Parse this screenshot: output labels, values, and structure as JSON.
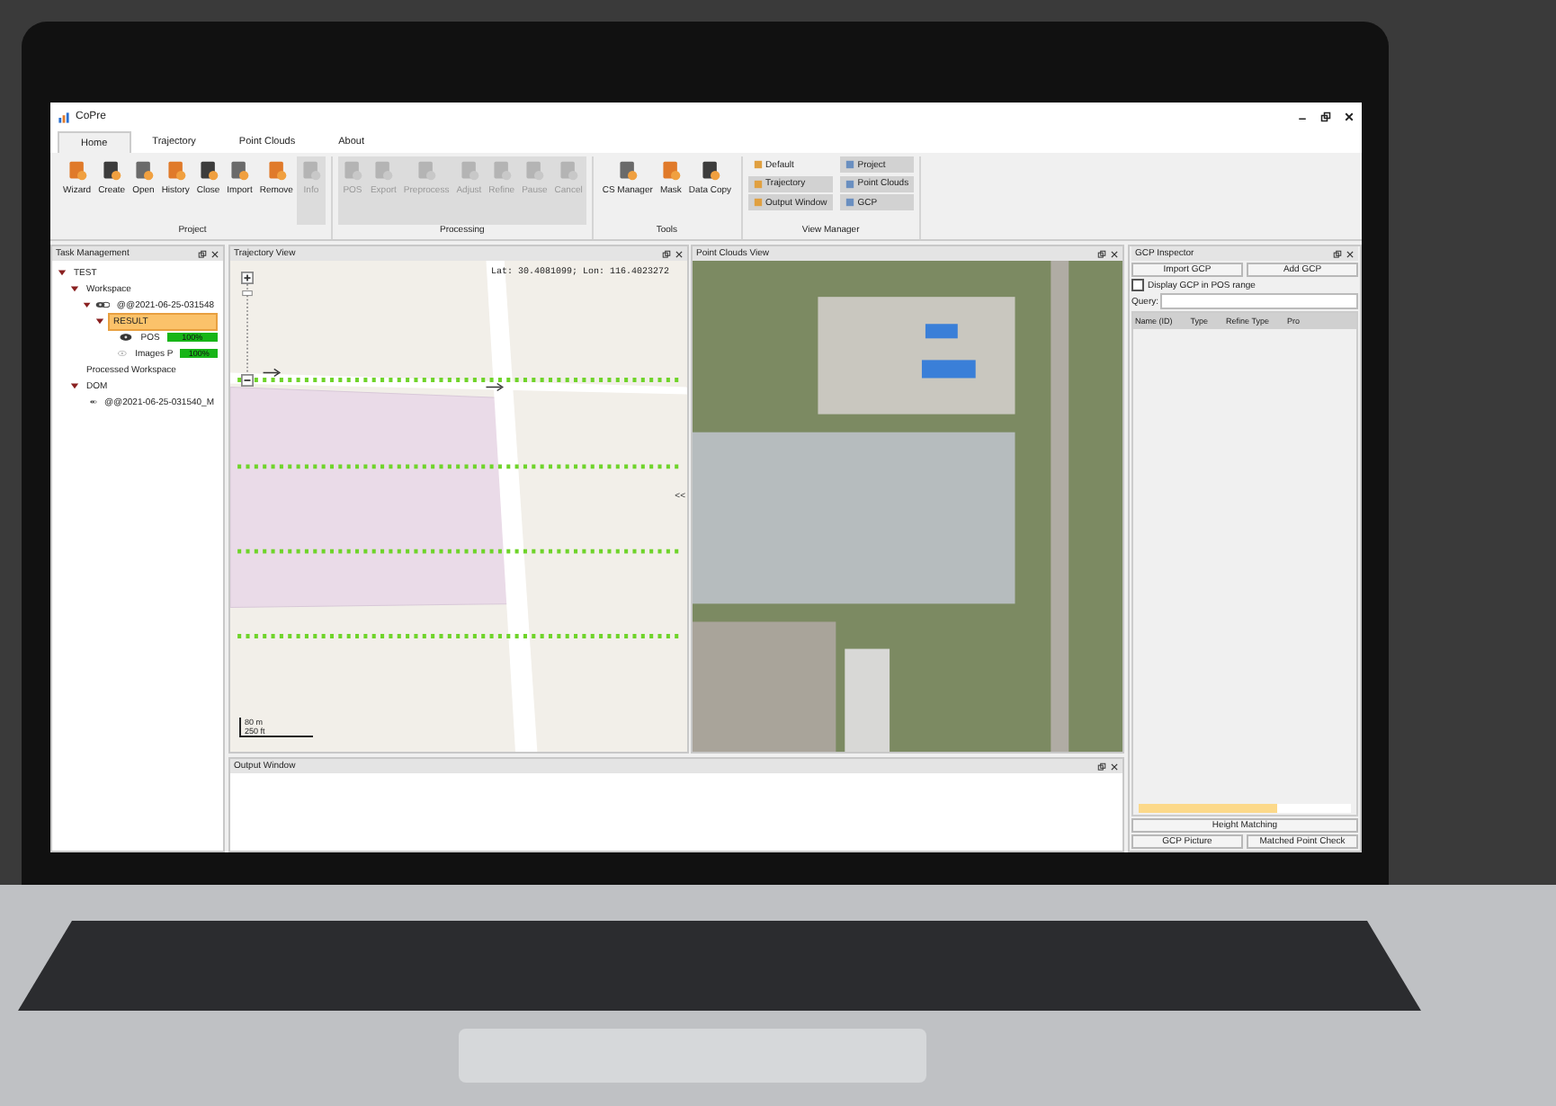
{
  "window": {
    "title": "CoPre"
  },
  "tabs": [
    {
      "label": "Home",
      "selected": true
    },
    {
      "label": "Trajectory",
      "selected": false
    },
    {
      "label": "Point Clouds",
      "selected": false
    },
    {
      "label": "About",
      "selected": false
    }
  ],
  "ribbon": [
    {
      "label": "Project",
      "kind": "buttons",
      "buttons": [
        {
          "label": "Wizard",
          "disabled": false
        },
        {
          "label": "Create",
          "disabled": false
        },
        {
          "label": "Open",
          "disabled": false
        },
        {
          "label": "History",
          "disabled": false
        },
        {
          "label": "Close",
          "disabled": false
        },
        {
          "label": "Import",
          "disabled": false
        },
        {
          "label": "Remove",
          "disabled": false
        },
        {
          "label": "Info",
          "disabled": true
        }
      ]
    },
    {
      "label": "Processing",
      "kind": "buttons",
      "buttons": [
        {
          "label": "POS",
          "disabled": true
        },
        {
          "label": "Export",
          "disabled": true
        },
        {
          "label": "Preprocess",
          "disabled": true
        },
        {
          "label": "Adjust",
          "disabled": true
        },
        {
          "label": "Refine",
          "disabled": true
        },
        {
          "label": "Pause",
          "disabled": true
        },
        {
          "label": "Cancel",
          "disabled": true
        }
      ]
    },
    {
      "label": "Tools",
      "kind": "buttons",
      "buttons": [
        {
          "label": "CS Manager",
          "disabled": false
        },
        {
          "label": "Mask",
          "disabled": false
        },
        {
          "label": "Data Copy",
          "disabled": false
        }
      ]
    },
    {
      "label": "View Manager",
      "kind": "toggles",
      "buttons": [
        {
          "label": "Default",
          "selected": false
        },
        {
          "label": "Project",
          "selected": true
        },
        {
          "label": "Trajectory",
          "selected": true
        },
        {
          "label": "Point Clouds",
          "selected": true
        },
        {
          "label": "Output Window",
          "selected": true
        },
        {
          "label": "GCP",
          "selected": true
        }
      ]
    }
  ],
  "task_management": {
    "title": "Task Management",
    "tree": [
      {
        "label": "TEST",
        "expanded": true,
        "selected": false,
        "children": [
          {
            "label": "Workspace",
            "expanded": true,
            "selected": false,
            "children": [
              {
                "label": "@@2021-06-25-031548",
                "kind": "dataset",
                "expanded": true,
                "selected": false,
                "children": [
                  {
                    "label": "RESULT",
                    "expanded": true,
                    "selected": true,
                    "children": [
                      {
                        "label": "POS",
                        "kind": "layer",
                        "selected": false,
                        "visible": true,
                        "level": 1,
                        "reading": "100%"
                      },
                      {
                        "label": "Images P",
                        "kind": "layer",
                        "selected": false,
                        "visible": false,
                        "level": 1,
                        "reading": "100%"
                      }
                    ]
                  }
                ]
              }
            ]
          },
          {
            "label": "Processed Workspace",
            "selected": false
          },
          {
            "label": "DOM",
            "expanded": true,
            "selected": false,
            "children": [
              {
                "label": "@@2021-06-25-031540_M",
                "kind": "dataset",
                "selected": false
              }
            ]
          }
        ]
      }
    ]
  },
  "trajectory_view": {
    "title": "Trajectory View",
    "coordinates": "Lat: 30.4081099; Lon: 116.4023272",
    "zoom": {
      "level": 0.92
    },
    "scale": [
      "80 m",
      "250 ft"
    ],
    "collapse": "<<"
  },
  "point_clouds_view": {
    "title": "Point Clouds View"
  },
  "output_window": {
    "title": "Output Window"
  },
  "gcp_inspector": {
    "title": "GCP Inspector",
    "buttons": [
      "Import GCP",
      "Add GCP"
    ],
    "display_in_range": {
      "label": "Display GCP in POS range",
      "checked": false
    },
    "query_label": "Query:",
    "columns": [
      "Name (ID)",
      "Type",
      "Refine Type",
      "Pro"
    ],
    "bottom_buttons": [
      "Height Matching",
      "GCP Picture",
      "Matched Point Check"
    ]
  }
}
